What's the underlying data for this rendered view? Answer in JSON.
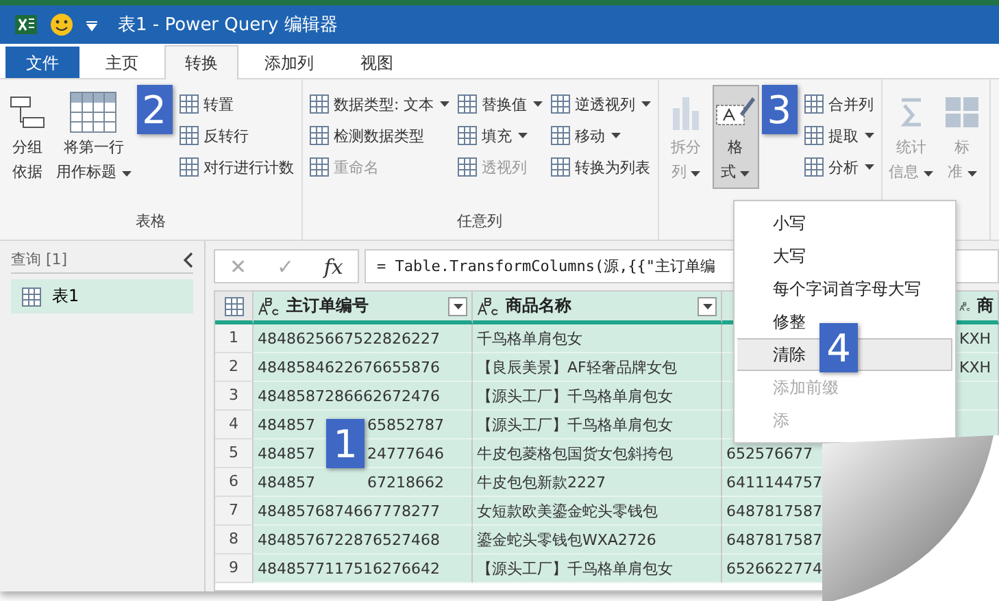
{
  "window": {
    "title": "表1 - Power Query 编辑器"
  },
  "tabs": [
    {
      "label": "文件",
      "kind": "file",
      "selected": false
    },
    {
      "label": "主页",
      "kind": "tab",
      "selected": false
    },
    {
      "label": "转换",
      "kind": "tab",
      "selected": true
    },
    {
      "label": "添加列",
      "kind": "tab",
      "selected": false
    },
    {
      "label": "视图",
      "kind": "tab",
      "selected": false
    }
  ],
  "ribbon": {
    "groups": [
      {
        "label": "表格",
        "items": [
          {
            "kind": "large",
            "lines": [
              "分组",
              "依据"
            ],
            "dropdown": false,
            "disabled": false,
            "pressed": false
          },
          {
            "kind": "large",
            "lines": [
              "将第一行",
              "用作标题"
            ],
            "dropdown": true,
            "disabled": false,
            "pressed": false
          },
          {
            "kind": "stack",
            "items": [
              {
                "label": "转置",
                "dropdown": false,
                "disabled": false
              },
              {
                "label": "反转行",
                "dropdown": false,
                "disabled": false
              },
              {
                "label": "对行进行计数",
                "dropdown": false,
                "disabled": false
              }
            ]
          }
        ]
      },
      {
        "label": "任意列",
        "items": [
          {
            "kind": "stack",
            "items": [
              {
                "label": "数据类型: 文本",
                "dropdown": true,
                "disabled": false
              },
              {
                "label": "检测数据类型",
                "dropdown": false,
                "disabled": false
              },
              {
                "label": "重命名",
                "dropdown": false,
                "disabled": true
              }
            ]
          },
          {
            "kind": "stack",
            "items": [
              {
                "label": "替换值",
                "dropdown": true,
                "disabled": false
              },
              {
                "label": "填充",
                "dropdown": true,
                "disabled": false
              },
              {
                "label": "透视列",
                "dropdown": false,
                "disabled": true
              }
            ]
          },
          {
            "kind": "stack",
            "items": [
              {
                "label": "逆透视列",
                "dropdown": true,
                "disabled": false
              },
              {
                "label": "移动",
                "dropdown": true,
                "disabled": false
              },
              {
                "label": "转换为列表",
                "dropdown": false,
                "disabled": false
              }
            ]
          }
        ]
      },
      {
        "items": [
          {
            "kind": "large",
            "lines": [
              "拆分",
              "列"
            ],
            "dropdown": true,
            "disabled": true,
            "pressed": false
          },
          {
            "kind": "large",
            "lines": [
              "格",
              "式"
            ],
            "dropdown": true,
            "disabled": false,
            "pressed": true
          },
          {
            "kind": "stack",
            "items": [
              {
                "label": "合并列",
                "dropdown": false,
                "disabled": false
              },
              {
                "label": "提取",
                "dropdown": true,
                "disabled": false
              },
              {
                "label": "分析",
                "dropdown": true,
                "disabled": false
              }
            ]
          }
        ]
      },
      {
        "items": [
          {
            "kind": "large",
            "lines": [
              "统计",
              "信息"
            ],
            "dropdown": true,
            "disabled": true,
            "pressed": false
          },
          {
            "kind": "large",
            "lines": [
              "标",
              "准"
            ],
            "dropdown": true,
            "disabled": true,
            "pressed": false
          }
        ]
      }
    ]
  },
  "queries": {
    "header": "查询 [1]",
    "items": [
      {
        "label": "表1",
        "selected": true
      }
    ]
  },
  "formula_buttons": [
    "✕",
    "✓",
    "fx"
  ],
  "formula": "= Table.TransformColumns(源,{{\"主订单编",
  "table": {
    "columns": [
      {
        "label": "主订单编号",
        "filter": true
      },
      {
        "label": "商品名称",
        "filter": true
      },
      {},
      {
        "label": "商"
      }
    ],
    "rows": [
      {
        "n": "1",
        "cells": [
          [
            "4848625667522826227"
          ],
          [
            "千鸟格单肩包女"
          ],
          [
            ""
          ],
          [
            "KXH"
          ]
        ]
      },
      {
        "n": "2",
        "cells": [
          [
            "4848584622676655876"
          ],
          [
            "【良辰美景】AF轻奢品牌女包"
          ],
          [
            ""
          ],
          [
            "KXH"
          ]
        ]
      },
      {
        "n": "3",
        "cells": [
          [
            "4848587286662672476"
          ],
          [
            "【源头工厂】千鸟格单肩包女"
          ],
          [
            ""
          ],
          [
            ""
          ]
        ]
      },
      {
        "n": "4",
        "cells": [
          [
            "484857",
            "65852787"
          ],
          [
            "【源头工厂】千鸟格单肩包女"
          ],
          [
            ""
          ],
          [
            ""
          ]
        ]
      },
      {
        "n": "5",
        "cells": [
          [
            "484857",
            "24777646"
          ],
          [
            "牛皮包菱格包国货女包斜挎包"
          ],
          [
            "652576677"
          ],
          [
            ""
          ]
        ]
      },
      {
        "n": "6",
        "cells": [
          [
            "484857",
            "67218662"
          ],
          [
            "牛皮包包新款2227"
          ],
          [
            "6411144757"
          ],
          [
            ""
          ]
        ]
      },
      {
        "n": "7",
        "cells": [
          [
            "4848576874667778277"
          ],
          [
            "女短款欧美鎏金蛇头零钱包"
          ],
          [
            "6487817587"
          ],
          [
            ""
          ]
        ]
      },
      {
        "n": "8",
        "cells": [
          [
            "4848576722876527468"
          ],
          [
            "鎏金蛇头零钱包WXA2726"
          ],
          [
            "6487817587"
          ]
        ]
      },
      {
        "n": "9",
        "cells": [
          [
            "4848577117516276642"
          ],
          [
            "【源头工厂】千鸟格单肩包女"
          ],
          [
            "6526622774"
          ]
        ]
      }
    ]
  },
  "menu": [
    {
      "label": "小写",
      "selected": false,
      "disabled": false
    },
    {
      "label": "大写",
      "selected": false,
      "disabled": false
    },
    {
      "label": "每个字词首字母大写",
      "selected": false,
      "disabled": false
    },
    {
      "label": "修整",
      "selected": false,
      "disabled": false
    },
    {
      "label": "清除",
      "selected": true,
      "disabled": false
    },
    {
      "label": "添加前缀",
      "selected": false,
      "disabled": true
    },
    {
      "label": "添",
      "selected": false,
      "disabled": true
    }
  ],
  "callouts": [
    "1",
    "2",
    "3",
    "4"
  ]
}
